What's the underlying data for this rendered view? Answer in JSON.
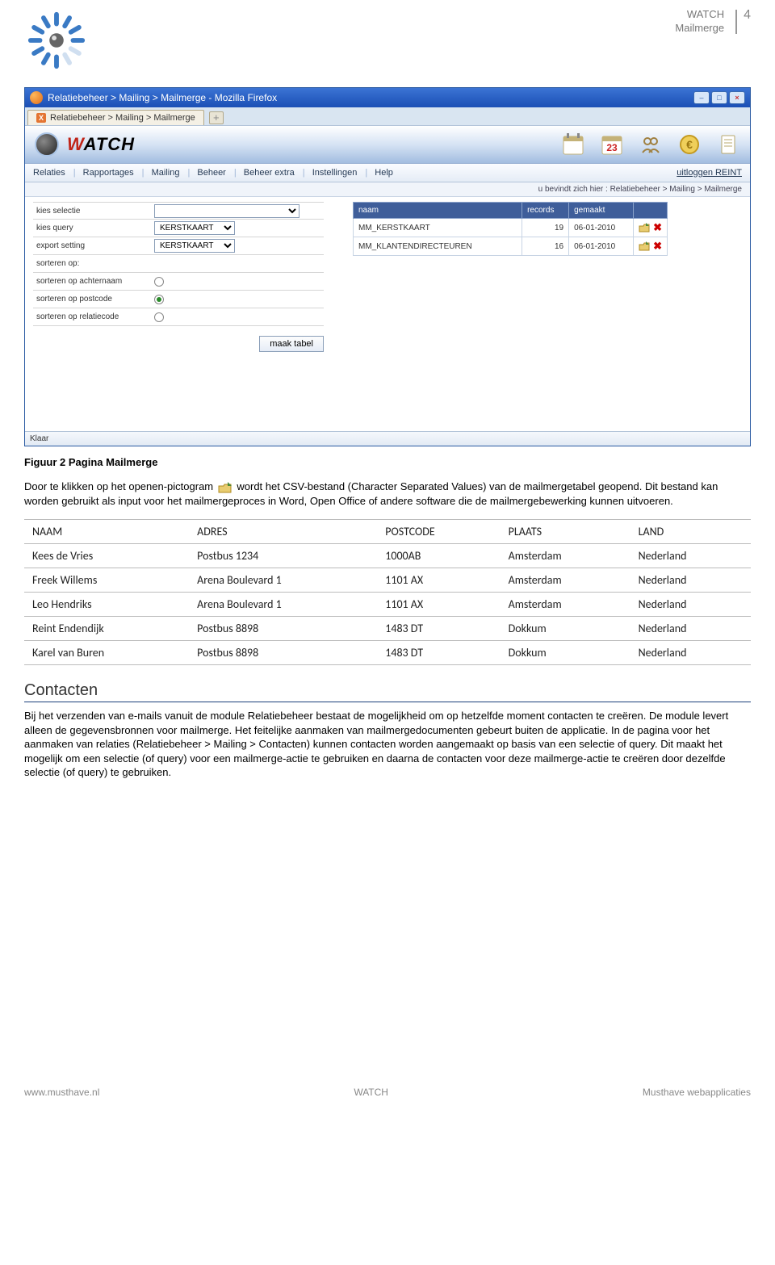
{
  "header": {
    "product": "WATCH",
    "module": "Mailmerge",
    "pagenum": "4"
  },
  "screenshot": {
    "window_title": "Relatiebeheer  >  Mailing > Mailmerge - Mozilla Firefox",
    "tab_label": "Relatiebeheer > Mailing > Mailmerge",
    "brand": "WATCH",
    "menu": {
      "relaties": "Relaties",
      "rapportages": "Rapportages",
      "mailing": "Mailing",
      "beheer": "Beheer",
      "beheer_extra": "Beheer extra",
      "instellingen": "Instellingen",
      "help": "Help",
      "logout": "uitloggen REINT"
    },
    "breadcrumb": "u bevindt zich hier : Relatiebeheer > Mailing > Mailmerge",
    "left": {
      "kies_selectie": "kies selectie",
      "kies_query": "kies query",
      "kies_query_val": "KERSTKAART",
      "export_setting": "export setting",
      "export_setting_val": "KERSTKAART",
      "sorteren_op": "sorteren op:",
      "sort_achternaam": "sorteren op achternaam",
      "sort_postcode": "sorteren op postcode",
      "sort_relatiecode": "sorteren op relatiecode",
      "btn": "maak tabel"
    },
    "table": {
      "h_naam": "naam",
      "h_records": "records",
      "h_gemaakt": "gemaakt",
      "rows": [
        {
          "naam": "MM_KERSTKAART",
          "records": "19",
          "gemaakt": "06-01-2010"
        },
        {
          "naam": "MM_KLANTENDIRECTEUREN",
          "records": "16",
          "gemaakt": "06-01-2010"
        }
      ]
    },
    "status": "Klaar"
  },
  "caption": "Figuur 2 Pagina Mailmerge",
  "para1a": "Door te klikken op het openen-pictogram ",
  "para1b": " wordt het CSV-bestand (Character Separated Values) van de mailmergetabel geopend. Dit bestand kan worden gebruikt als input voor het mailmergeproces in Word, Open Office of andere software die de mailmergebewerking kunnen uitvoeren.",
  "csv": {
    "headers": [
      "NAAM",
      "ADRES",
      "POSTCODE",
      "PLAATS",
      "LAND"
    ],
    "rows": [
      [
        "Kees de Vries",
        "Postbus 1234",
        "1000AB",
        "Amsterdam",
        "Nederland"
      ],
      [
        "Freek Willems",
        "Arena Boulevard 1",
        "1101 AX",
        "Amsterdam",
        "Nederland"
      ],
      [
        "Leo Hendriks",
        "Arena Boulevard 1",
        "1101 AX",
        "Amsterdam",
        "Nederland"
      ],
      [
        "Reint Endendijk",
        "Postbus 8898",
        "1483 DT",
        "Dokkum",
        "Nederland"
      ],
      [
        "Karel van Buren",
        "Postbus 8898",
        "1483 DT",
        "Dokkum",
        "Nederland"
      ]
    ]
  },
  "section_title": "Contacten",
  "para2": "Bij het verzenden van e-mails vanuit de module Relatiebeheer bestaat de mogelijkheid om op hetzelfde moment contacten te creëren. De module levert alleen de gegevensbronnen voor mailmerge. Het feitelijke aanmaken van mailmergedocumenten gebeurt buiten de applicatie. In de pagina voor het aanmaken van relaties (Relatiebeheer > Mailing > Contacten) kunnen contacten worden aangemaakt op basis van een selectie of query. Dit maakt het mogelijk om een selectie (of query) voor een mailmerge-actie te gebruiken en daarna de contacten voor deze mailmerge-actie te creëren door dezelfde selectie (of query) te gebruiken.",
  "footer": {
    "left": "www.musthave.nl",
    "center": "WATCH",
    "right": "Musthave webapplicaties"
  }
}
